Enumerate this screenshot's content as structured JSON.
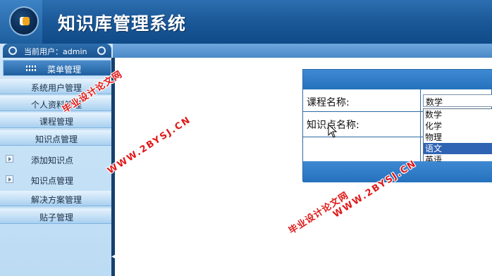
{
  "app": {
    "title": "知识库管理系统"
  },
  "user": {
    "text": "当前用户：admin"
  },
  "sidebar": {
    "header_label": "菜单管理",
    "items": [
      {
        "label": "系统用户管理"
      },
      {
        "label": "个人资料管理"
      },
      {
        "label": "课程管理"
      },
      {
        "label": "知识点管理"
      }
    ],
    "sub_items": [
      {
        "label": "添加知识点"
      },
      {
        "label": "知识点管理"
      }
    ],
    "items_after": [
      {
        "label": "解决方案管理"
      },
      {
        "label": "贴子管理"
      }
    ]
  },
  "form": {
    "course_label": "课程名称:",
    "knowledge_label": "知识点名称:",
    "course_select": {
      "value": "数学",
      "options": [
        "数学",
        "化学",
        "物理",
        "语文",
        "英语"
      ],
      "highlighted": "语文"
    }
  },
  "watermarks": {
    "w1": "毕业设计论文网",
    "w2": "WWW.2BYSJ.CN",
    "w3": "毕业设计论文网",
    "w4": "WWW.2BYSJ.CN"
  },
  "colors": {
    "header_blue": "#1c5a9a",
    "sidebar_light": "#cfe6f8",
    "selection": "#2f64b4",
    "watermark_red": "#e01818"
  }
}
